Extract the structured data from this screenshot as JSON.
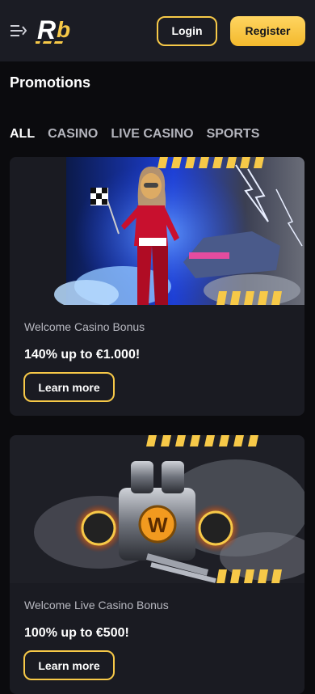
{
  "header": {
    "logo_text": "Rb",
    "login_label": "Login",
    "register_label": "Register"
  },
  "page": {
    "title": "Promotions"
  },
  "tabs": [
    {
      "label": "ALL",
      "active": true
    },
    {
      "label": "CASINO",
      "active": false
    },
    {
      "label": "LIVE CASINO",
      "active": false
    },
    {
      "label": "SPORTS",
      "active": false
    }
  ],
  "promos": [
    {
      "subtitle": "Welcome Casino Bonus",
      "headline": "140% up to €1.000!",
      "button_label": "Learn more",
      "image": "racing-woman-banner"
    },
    {
      "subtitle": "Welcome Live Casino Bonus",
      "headline": "100% up to €500!",
      "button_label": "Learn more",
      "image": "motor-engine-banner"
    }
  ],
  "colors": {
    "accent": "#f7c948",
    "header_bg": "#1b1c24",
    "card_bg": "#1a1b22",
    "page_bg": "#0b0b0e"
  }
}
